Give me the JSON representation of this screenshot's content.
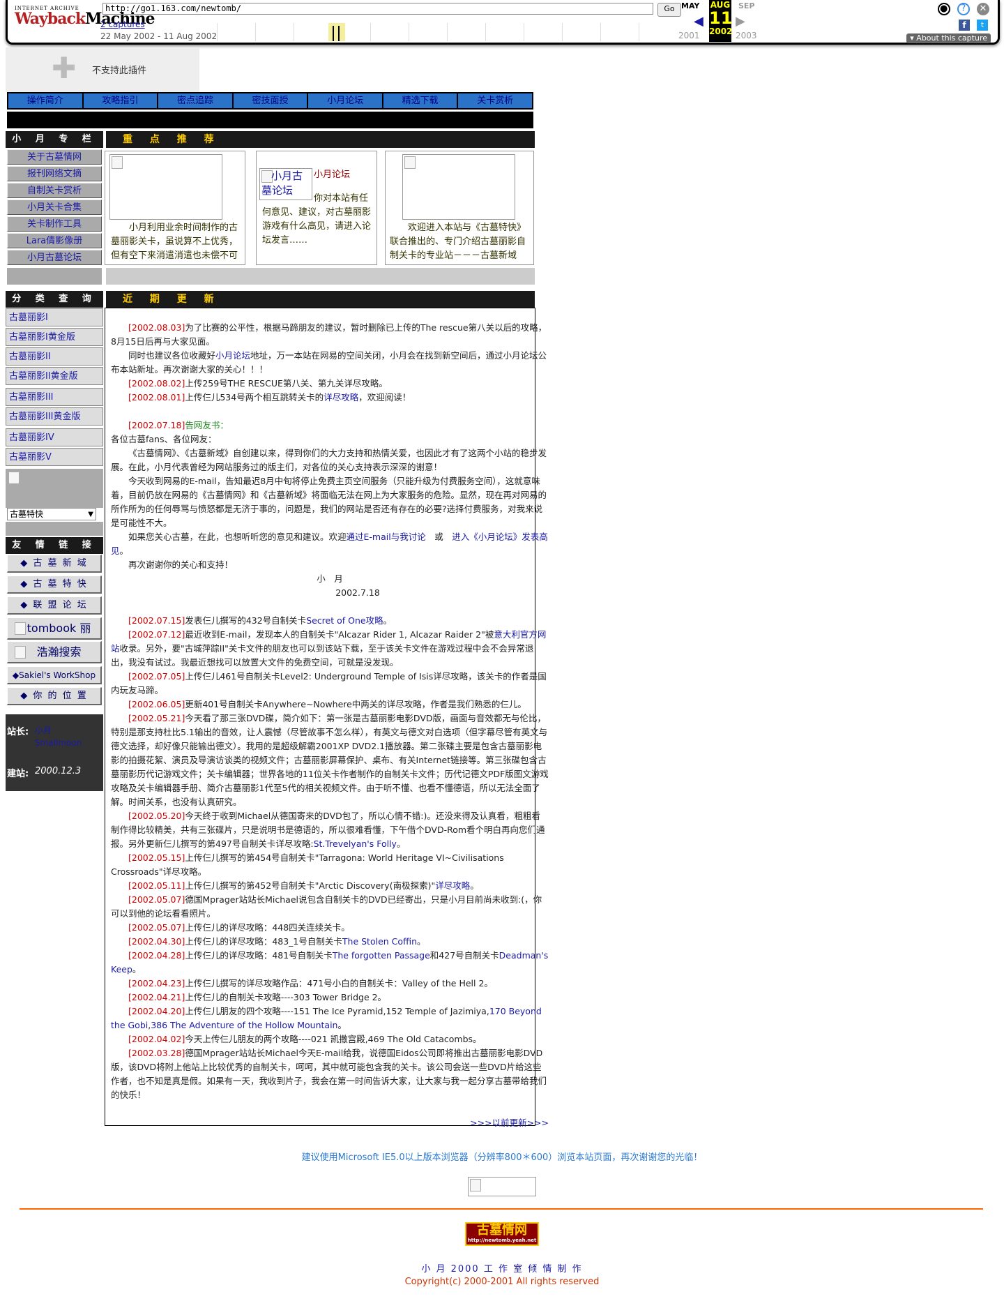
{
  "wayback": {
    "url": "http://go1.163.com/newtomb/",
    "go_label": "Go",
    "captures_label": "2 captures",
    "date_range": "22 May 2002 - 11 Aug 2002",
    "month_prev": "MAY",
    "month_current": "AUG",
    "month_next": "SEP",
    "day": "11",
    "year_prev": "2001",
    "year_current": "2002",
    "year_next": "2003",
    "about_label": "▾ About this capture",
    "logo_top": "INTERNET ARCHIVE",
    "logo_wayback": "Wayback",
    "logo_machine": "Machine"
  },
  "plugin": {
    "message": "不支持此插件"
  },
  "topnav": [
    "操作简介",
    "攻略指引",
    "密点追踪",
    "密技面授",
    "小月论坛",
    "精选下载",
    "关卡赏析"
  ],
  "left": {
    "column_title": "小 月 专 栏",
    "column_items": [
      "关于古墓情网",
      "报刊网络文摘",
      "自制关卡赏析",
      "小月关卡合集",
      "关卡制作工具",
      "Lara倩影像册",
      "小月古墓论坛"
    ],
    "category_title": "分 类 查 询",
    "category_items": [
      "古墓丽影I",
      "古墓丽影I黄金版",
      "古墓丽影II",
      "古墓丽影II黄金版",
      "古墓丽影III",
      "古墓丽影III黄金版",
      "古墓丽影IV",
      "古墓丽影V"
    ],
    "select_value": "古墓特快",
    "friends_title": "友 情 链 接",
    "friends_items": [
      "◆ 古 墓 新 域",
      "◆ 古 墓 特 快",
      "◆ 联 盟 论 坛"
    ],
    "tombook_label": "tombook 丽",
    "search_label": "浩瀚搜索",
    "workshop_label": "◆Sakiel's WorkShop",
    "location_label": "◆ 你 的 位 置",
    "owner_label": "站长:",
    "owner_name": "小月 Smallmoon",
    "built_label": "建站:",
    "built_date": "2000.12.3"
  },
  "featured": {
    "title": "重 点 推 荐",
    "card1_text": "小月利用业余时间制作的古墓丽影关卡，虽说算不上优秀，但有空下来消遣消遣也未偿不可",
    "card2_img_alt": "小月古墓论坛",
    "card2_title": "小月论坛",
    "card2_text": "你对本站有任何意见、建议，对古墓丽影游戏有什么高见，请进入论坛发言……",
    "card3_text": "欢迎进入本站与《古墓特快》联合推出的、专门介绍古墓丽影自制关卡的专业站－－－古墓新域"
  },
  "updates": {
    "title": "近 期 更 新",
    "entries": [
      {
        "date": "[2002.08.03]",
        "text": "为了比赛的公平性，根据马蹄朋友的建议，暂时删除已上传的The rescue第八关以后的攻略，8月15日后再与大家见面。"
      },
      {
        "pre": "同时也建议各位收藏好",
        "link": "小月论坛",
        "text": "地址，万一本站在网易的空间关闭，小月会在找到新空间后，通过小月论坛公布本站新址。再次谢谢大家的关心！！！"
      },
      {
        "date": "[2002.08.02]",
        "text": "上传259号THE RESCUE第八关、第九关详尽攻略。"
      },
      {
        "date": "[2002.08.01]",
        "text": "上传仨儿534号两个相互跳转关卡的",
        "link": "详尽攻略",
        "post": "，欢迎阅读！"
      }
    ],
    "letter_date": "[2002.07.18]",
    "letter_title": "告网友书：",
    "letter_greeting": "各位古墓fans、各位网友：",
    "letter_p1": "《古墓情网》、《古墓新域》自创建以来，得到你们的大力支持和热情关爱，也因此才有了这两个小站的稳步发展。在此，小月代表曾经为网站服务过的版主们，对各位的关心支持表示深深的谢意！",
    "letter_p2": "今天收到网易的E-mail，告知最迟8月中旬将停止免费主页空间服务（只能升级为付费服务空间），这就意味着，目前仍放在网易的《古墓情网》和《古墓新域》将面临无法在网上为大家服务的危险。显然，现在再对网易的所作所为的任何辱骂与愤怒都是无济于事的，问题是，我们的网站是否还有存在的必要?选择付费服务，对我来说是可能性不大。",
    "letter_p3_pre": "如果您关心古墓，在此，也想听听您的意见和建议。欢迎",
    "letter_p3_link1": "通过E-mail与我讨论",
    "letter_p3_mid": "　或　",
    "letter_p3_link2": "进入《小月论坛》发表高见",
    "letter_p3_post": "。",
    "letter_p4": "再次谢谢你的关心和支持！",
    "letter_sign": "小　月",
    "letter_sign_date": "2002.7.18",
    "more": [
      {
        "date": "[2002.07.15]",
        "text": "发表仨儿撰写的432号自制关卡",
        "link": "Secret of One攻略",
        "post": "。"
      },
      {
        "date": "[2002.07.12]",
        "text": "最近收到E-mail，发现本人的自制关卡\"Alcazar Rider 1, Alcazar Raider 2\"被",
        "link": "意大利官方网站",
        "post": "收录。另外，要\"古城萍踪II\"关卡文件的朋友也可以到该站下载，至于该关卡文件在游戏过程中会不会异常退出，我没有试过。我最近想找可以放置大文件的免费空间，可就是没发现。"
      },
      {
        "date": "[2002.07.05]",
        "text": "上传仨儿461号自制关卡Level2: Underground Temple of Isis详尽攻略，该关卡的作者是国内玩友马蹄。"
      },
      {
        "date": "[2002.06.05]",
        "text": "更新401号自制关卡Anywhere~Nowhere中两关的详尽攻略，作者是我们熟悉的仨儿。"
      },
      {
        "date": "[2002.05.21]",
        "text": "今天看了那三张DVD碟，简介如下：第一张是古墓丽影电影DVD版，画面与音效都无与伦比，特别是那支持杜比5.1输出的音效，让人震憾（尽管故事不怎么样），有英文与德文对白选项（但字幕尽管有英文与德文选择，却好像只能输出德文）。我用的是超级解霸2001XP DVD2.1播放器。第二张碟主要是包含古墓丽影电影的拍摄花絮、演员及导演访谈类的视频文件；古墓丽影屏幕保护、桌布、有关Internet链接等。第三张碟包含古墓丽影历代记游戏文件；关卡编辑器；世界各地的11位关卡作者制作的自制关卡文件；历代记德文PDF版图文游戏攻略及关卡编辑器手册、简介古墓丽影1代至5代的相关视频文件。由于听不懂、也看不懂德语，所以无法全面了解。时间关系，也没有认真研究。"
      },
      {
        "date": "[2002.05.20]",
        "text": "今天终于收到Michael从德国寄来的DVD包了，所以心情不错:)。还没来得及认真看，粗粗看制作得比较精美，共有三张碟片，只是说明书是德语的，所以很难看懂，下午借个DVD-Rom看个明白再向您们通报。另外更新仨儿撰写的第497号自制关卡详尽攻略:",
        "link": "St.Trevelyan's Folly",
        "post": "。"
      },
      {
        "date": "[2002.05.15]",
        "text": "上传仨儿撰写的第454号自制关卡\"Tarragona: World Heritage VI~Civilisations Crossroads\"详尽攻略。"
      },
      {
        "date": "[2002.05.11]",
        "text": "上传仨儿撰写的第452号自制关卡\"Arctic Discovery(南极探索)\"",
        "link": "详尽攻略",
        "post": "。"
      },
      {
        "date": "[2002.05.07]",
        "text": "德国Mprager站站长Michael说包含自制关卡的DVD已经寄出，只是小月目前尚未收到:(，你可以到他的论坛看看照片。"
      },
      {
        "date": "[2002.05.07]",
        "text": "上传仨儿的详尽攻略：448四关连续关卡。"
      },
      {
        "date": "[2002.04.30]",
        "text": "上传仨儿的详尽攻略：483_1号自制关卡",
        "link": "The Stolen Coffin",
        "post": "。"
      },
      {
        "date": "[2002.04.28]",
        "text": "上传仨儿的详尽攻略：481号自制关卡",
        "link": "The forgotten Passage",
        "post": "和427号自制关卡",
        "link2": "Deadman's Keep",
        "post2": "。"
      },
      {
        "date": "[2002.04.23]",
        "text": "上传仨儿撰写的详尽攻略作品：471号小白的自制关卡：Valley of the Hell 2",
        "post": "。"
      },
      {
        "date": "[2002.04.21]",
        "text": "上传仨儿的自制关卡攻略----303 Tower Bridge 2。"
      },
      {
        "date": "[2002.04.20]",
        "text": "上传仨儿朋友的四个攻略----151 The Ice Pyramid,152 Temple of Jazimiya,",
        "link": "170 Beyond the Gobi",
        "post": ",",
        "link2": "386 The Adventure of the Hollow Mountain",
        "post2": "。"
      },
      {
        "date": "[2002.04.02]",
        "text": "今天上传仨儿朋友的两个攻略----021 凯撒宫殿,469 The Old Catacombs。"
      },
      {
        "date": "[2002.03.28]",
        "text": "德国Mprager站站长Michael今天E-mail给我，说德国Eidos公司即将推出古墓丽影电影DVD版，该DVD将附上他站上比较优秀的自制关卡，呵呵，其中就可能包含我的关卡。该公司会送一些DVD片给这些作者，也不知是真是假。如果有一天，我收到片子，我会在第一时间告诉大家，让大家与我一起分享古墓带给我们的快乐！"
      }
    ],
    "more_link": ">>>以前更新>>>"
  },
  "footer": {
    "browser_note": "建议使用Microsoft IE5.0以上版本浏览器（分辨率800＊600）浏览本站页面，再次谢谢您的光临！",
    "logo_text": "古墓情网",
    "logo_url": "http://newtomb.yeah.net",
    "credit": "小 月 2000 工 作 室 倾 情 制 作",
    "copyright": "Copyright(c) 2000-2001 All rights reserved"
  }
}
